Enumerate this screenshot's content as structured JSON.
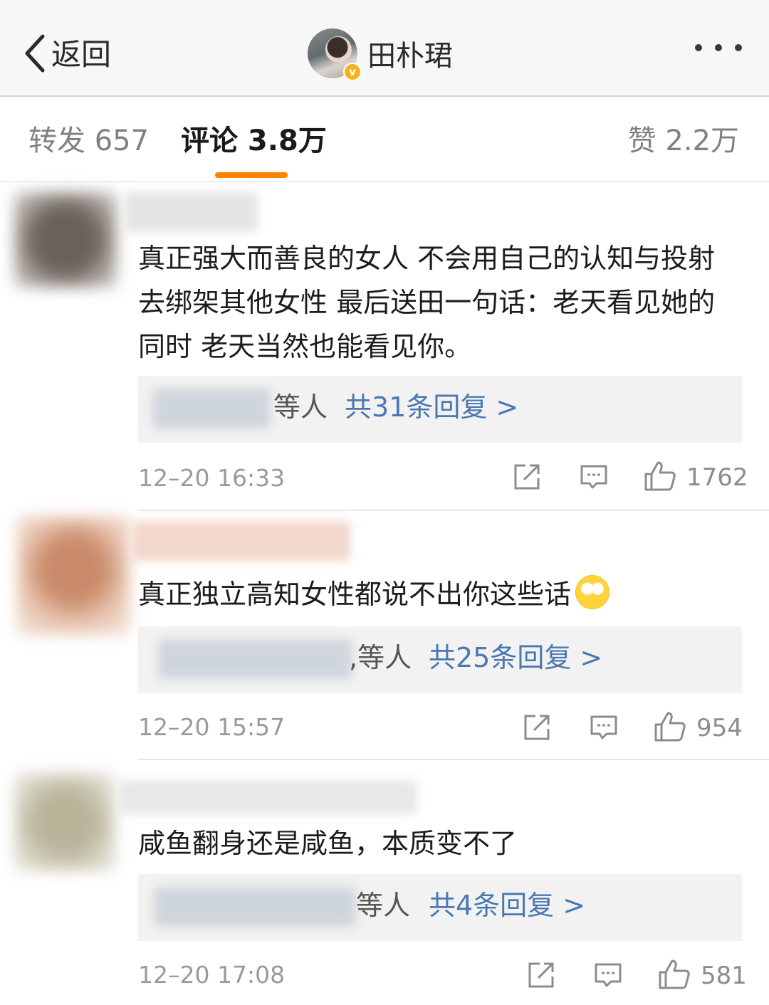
{
  "header": {
    "back_label": "返回",
    "profile_name": "田朴珺",
    "verified_badge": "v",
    "accent_color": "#f5b21b"
  },
  "tabs": {
    "reposts_label": "转发 657",
    "comments_label": "评论 3.8万",
    "likes_label": "赞 2.2万",
    "active_underline_color": "#ff8200"
  },
  "comments": [
    {
      "text": "真正强大而善良的女人 不会用自己的认知与投射去绑架其他女性 最后送田一句话：老天看见她的同时 老天当然也能看见你。",
      "reply_suffix": "等人",
      "reply_link": "共31条回复 >",
      "time": "12–20 16:33",
      "likes": "1762"
    },
    {
      "text": "真正独立高知女性都说不出你这些话",
      "emoji": "rolling-eyes-emoji",
      "reply_suffix": ",等人",
      "reply_link": "共25条回复 >",
      "time": "12–20 15:57",
      "likes": "954"
    },
    {
      "text": "咸鱼翻身还是咸鱼，本质变不了",
      "reply_suffix": "等人",
      "reply_link": "共4条回复 >",
      "time": "12–20 17:08",
      "likes": "581"
    }
  ],
  "icons": {
    "back": "chevron-left-icon",
    "more": "more-dots-icon",
    "repost": "share-icon",
    "comment": "comment-icon",
    "like": "thumbs-up-icon"
  },
  "colors": {
    "link": "#4a78b0",
    "meta_text": "#9a9a9a",
    "reply_bg": "#f2f2f2"
  }
}
